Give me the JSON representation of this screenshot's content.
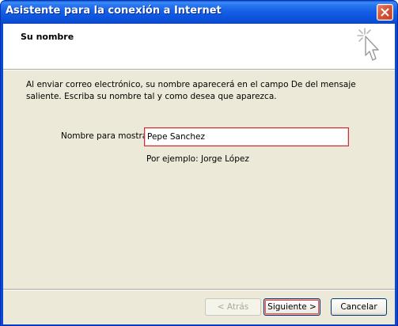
{
  "window": {
    "title": "Asistente para la conexión a Internet"
  },
  "header": {
    "title": "Su nombre",
    "icon": "wizard-sparkle-cursor-icon"
  },
  "main": {
    "intro": "Al enviar correo electrónico, su nombre aparecerá en el campo De del mensaje saliente. Escriba su nombre tal y como desea que aparezca.",
    "display_name_label": "Nombre para mostrar:",
    "display_name_value": "Pepe Sanchez",
    "example": "Por ejemplo: Jorge López"
  },
  "buttons": {
    "back": "< Atrás",
    "next": "Siguiente >",
    "cancel": "Cancelar"
  },
  "colors": {
    "titlebar": "#0a5fe0",
    "dialog_bg": "#ece9d8",
    "focus_border": "#c4323e",
    "close_button": "#d85a3a"
  }
}
